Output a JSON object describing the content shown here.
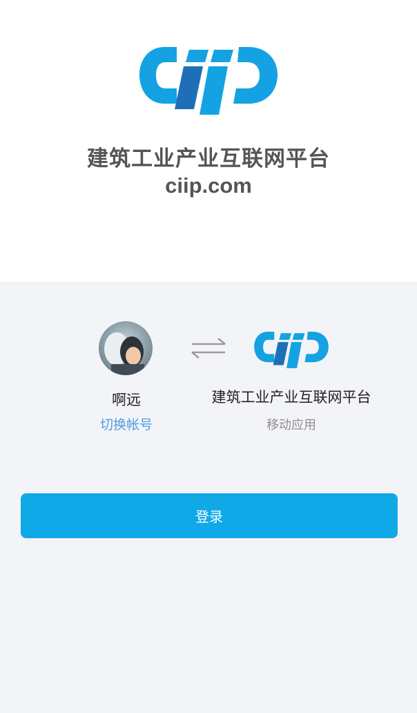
{
  "header": {
    "logo_icon": "ciip-logo-icon",
    "platform_title": "建筑工业产业互联网平台",
    "domain": "ciip.com"
  },
  "auth": {
    "user": {
      "avatar_icon": "user-avatar",
      "name": "啊远",
      "switch_label": "切换帐号"
    },
    "swap_icon": "swap-arrows-icon",
    "app": {
      "logo_icon": "ciip-logo-icon",
      "name": "建筑工业产业互联网平台",
      "type": "移动应用"
    },
    "login_label": "登录"
  },
  "colors": {
    "brand_light_blue": "#14a2e3",
    "brand_dark_blue": "#1e6fb8",
    "button": "#10a9e8",
    "link": "#4a9de0",
    "panel_background": "#f3f4f8"
  }
}
